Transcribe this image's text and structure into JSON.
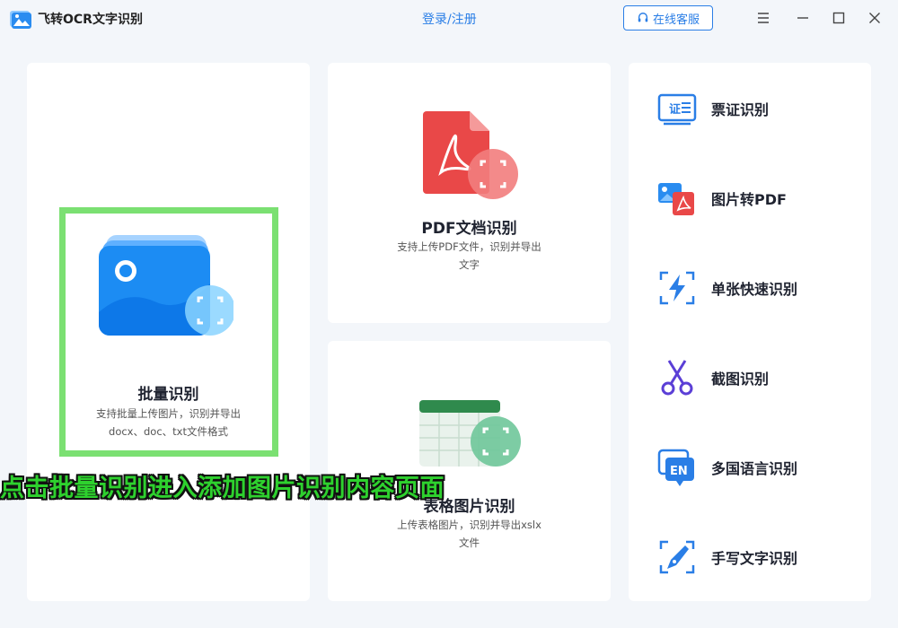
{
  "app": {
    "title": "飞转OCR文字识别",
    "login": "登录/注册",
    "support": "在线客服"
  },
  "cards": {
    "batch": {
      "title": "批量识别",
      "desc_line1": "支持批量上传图片，识别并导出",
      "desc_line2": "docx、doc、txt文件格式"
    },
    "pdf": {
      "title": "PDF文档识别",
      "desc_line1": "支持上传PDF文件，识别并导出",
      "desc_line2": "文字"
    },
    "table": {
      "title": "表格图片识别",
      "desc_line1": "上传表格图片，识别并导出xslx",
      "desc_line2": "文件"
    }
  },
  "tools": [
    {
      "label": "票证识别",
      "icon": "id-card-icon"
    },
    {
      "label": "图片转PDF",
      "icon": "image-to-pdf-icon"
    },
    {
      "label": "单张快速识别",
      "icon": "lightning-scan-icon"
    },
    {
      "label": "截图识别",
      "icon": "scissors-icon"
    },
    {
      "label": "多国语言识别",
      "icon": "language-en-icon"
    },
    {
      "label": "手写文字识别",
      "icon": "pen-nib-icon"
    }
  ],
  "tool_icon_text": {
    "id_card": "证",
    "language": "EN"
  },
  "overlay": {
    "caption": "点击批量识别进入添加图片识别内容页面"
  },
  "colors": {
    "accent": "#2a7ee6",
    "highlight": "#7be072",
    "pdf_red": "#e94848",
    "excel_green": "#2f8a4d"
  }
}
